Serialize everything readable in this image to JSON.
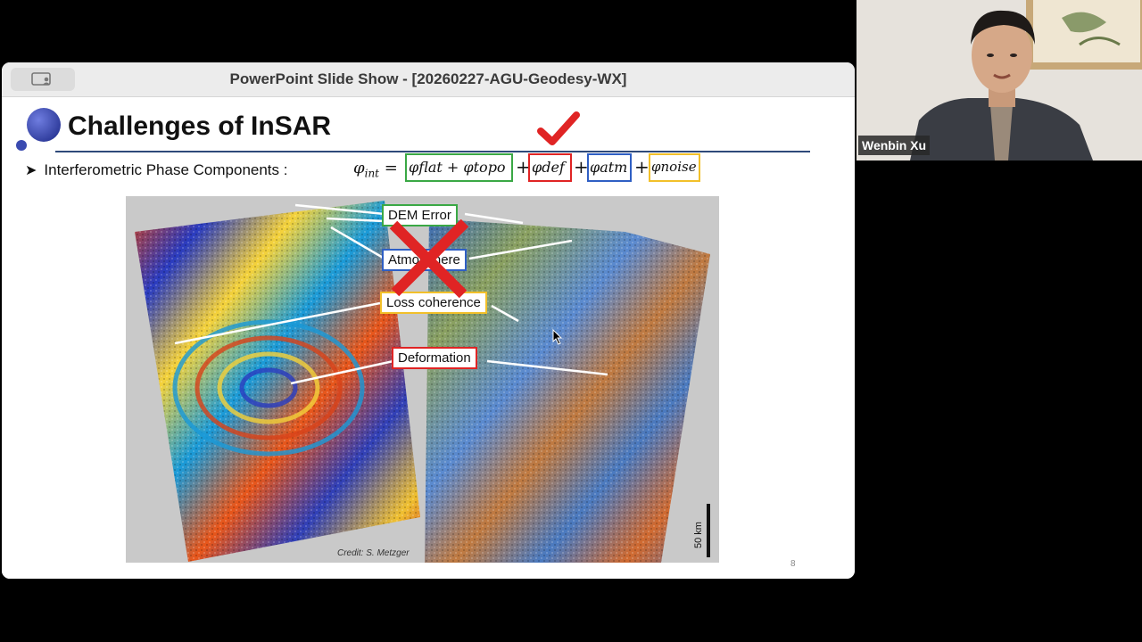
{
  "window": {
    "title": "PowerPoint Slide Show - [20260227-AGU-Geodesy-WX]"
  },
  "slide": {
    "title": "Challenges of InSAR",
    "bullet": "Interferometric Phase Components :",
    "equation": {
      "lhs": "φ",
      "lhs_sub": "int",
      "terms": [
        {
          "text": "φflat + φtopo",
          "box_color": "#3aa845"
        },
        {
          "text": "φdef",
          "box_color": "#e02424"
        },
        {
          "text": "φatm",
          "box_color": "#2f5fc4"
        },
        {
          "text": "φnoise",
          "box_color": "#f2c02a"
        }
      ]
    },
    "labels": {
      "dem_error": "DEM Error",
      "atmosphere": "Atmosphere",
      "loss_coherence": "Loss coherence",
      "deformation": "Deformation"
    },
    "credit": "Credit: S. Metzger",
    "scale": "50 km",
    "page_number": "8"
  },
  "webcam": {
    "name": "Wenbin Xu"
  },
  "colors": {
    "title_rule": "#2e4a7a",
    "check": "#e02424",
    "cross": "#e02424"
  }
}
